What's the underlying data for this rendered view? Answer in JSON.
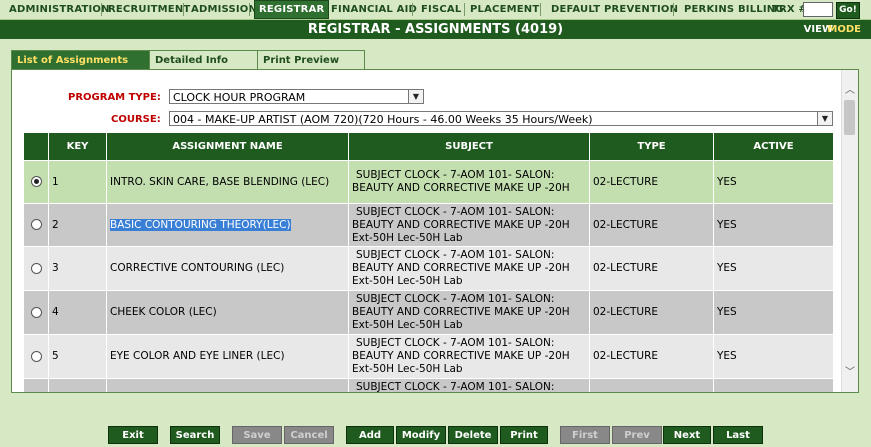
{
  "nav": {
    "items": [
      "ADMINISTRATION",
      "RECRUITMENT",
      "ADMISSION",
      "REGISTRAR",
      "FINANCIAL AID",
      "FISCAL",
      "PLACEMENT",
      "DEFAULT PREVENTION",
      "PERKINS BILLING"
    ],
    "active": "REGISTRAR",
    "trx_label": "TRX #:",
    "go_label": "Go!"
  },
  "titlebar": {
    "title": "REGISTRAR - ASSIGNMENTS (4019)",
    "view": "VIEW",
    "mode": "MODE"
  },
  "tabs": [
    "List of Assignments",
    "Detailed Info",
    "Print Preview"
  ],
  "filters": {
    "program_label": "PROGRAM TYPE:",
    "program_value": "CLOCK HOUR PROGRAM",
    "course_label": "COURSE:",
    "course_value": "004 - MAKE-UP ARTIST (AOM 720)(720 Hours - 46.00 Weeks 35 Hours/Week)"
  },
  "table": {
    "headers": [
      "",
      "KEY",
      "ASSIGNMENT NAME",
      "SUBJECT",
      "TYPE",
      "ACTIVE"
    ],
    "rows": [
      {
        "key": "1",
        "name": "INTRO. SKIN CARE, BASE BLENDING (LEC)",
        "subject_l1": "SUBJECT CLOCK - 7-AOM 101- SALON:",
        "subject_l2": "BEAUTY AND CORRECTIVE MAKE UP -20H",
        "subject_l3": "",
        "type": "02-LECTURE",
        "active": "YES"
      },
      {
        "key": "2",
        "name": "BASIC CONTOURING THEORY(LEC)",
        "subject_l1": "SUBJECT CLOCK - 7-AOM 101- SALON:",
        "subject_l2": "BEAUTY AND CORRECTIVE MAKE UP -20H",
        "subject_l3": "Ext-50H Lec-50H Lab",
        "type": "02-LECTURE",
        "active": "YES"
      },
      {
        "key": "3",
        "name": "CORRECTIVE CONTOURING (LEC)",
        "subject_l1": "SUBJECT CLOCK - 7-AOM 101- SALON:",
        "subject_l2": "BEAUTY AND CORRECTIVE MAKE UP -20H",
        "subject_l3": "Ext-50H Lec-50H Lab",
        "type": "02-LECTURE",
        "active": "YES"
      },
      {
        "key": "4",
        "name": "CHEEK COLOR (LEC)",
        "subject_l1": "SUBJECT CLOCK - 7-AOM 101- SALON:",
        "subject_l2": "BEAUTY AND CORRECTIVE MAKE UP -20H",
        "subject_l3": "Ext-50H Lec-50H Lab",
        "type": "02-LECTURE",
        "active": "YES"
      },
      {
        "key": "5",
        "name": "EYE COLOR AND EYE LINER (LEC)",
        "subject_l1": "SUBJECT CLOCK - 7-AOM 101- SALON:",
        "subject_l2": "BEAUTY AND CORRECTIVE MAKE UP -20H",
        "subject_l3": "Ext-50H Lec-50H Lab",
        "type": "02-LECTURE",
        "active": "YES"
      },
      {
        "key": "",
        "name": "",
        "subject_l1": "SUBJECT CLOCK - 7-AOM 101- SALON:",
        "subject_l2": "",
        "subject_l3": "",
        "type": "",
        "active": ""
      }
    ]
  },
  "toolbar": {
    "exit": "Exit",
    "search": "Search",
    "save": "Save",
    "cancel": "Cancel",
    "add": "Add",
    "modify": "Modify",
    "delete": "Delete",
    "print": "Print",
    "first": "First",
    "prev": "Prev",
    "next": "Next",
    "last": "Last"
  }
}
